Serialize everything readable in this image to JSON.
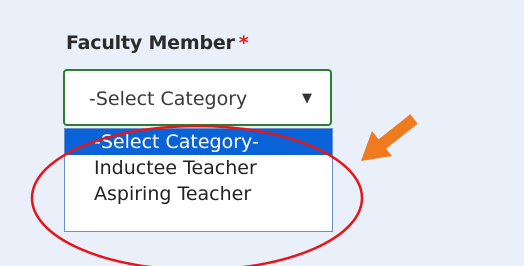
{
  "form": {
    "field_label": "Faculty Member",
    "required_mark": "*",
    "select": {
      "current_value": "-Select Category",
      "arrow_glyph": "▼",
      "options": [
        {
          "label": "-Select Category-",
          "selected": true
        },
        {
          "label": "Inductee Teacher",
          "selected": false
        },
        {
          "label": "Aspiring Teacher",
          "selected": false
        }
      ]
    }
  },
  "colors": {
    "background": "#e9f0fa",
    "select_border": "#2e7d32",
    "selected_option": "#0a63d6",
    "required": "#e02020",
    "annotation_circle": "#e8141b",
    "annotation_arrow": "#f07a1e"
  }
}
